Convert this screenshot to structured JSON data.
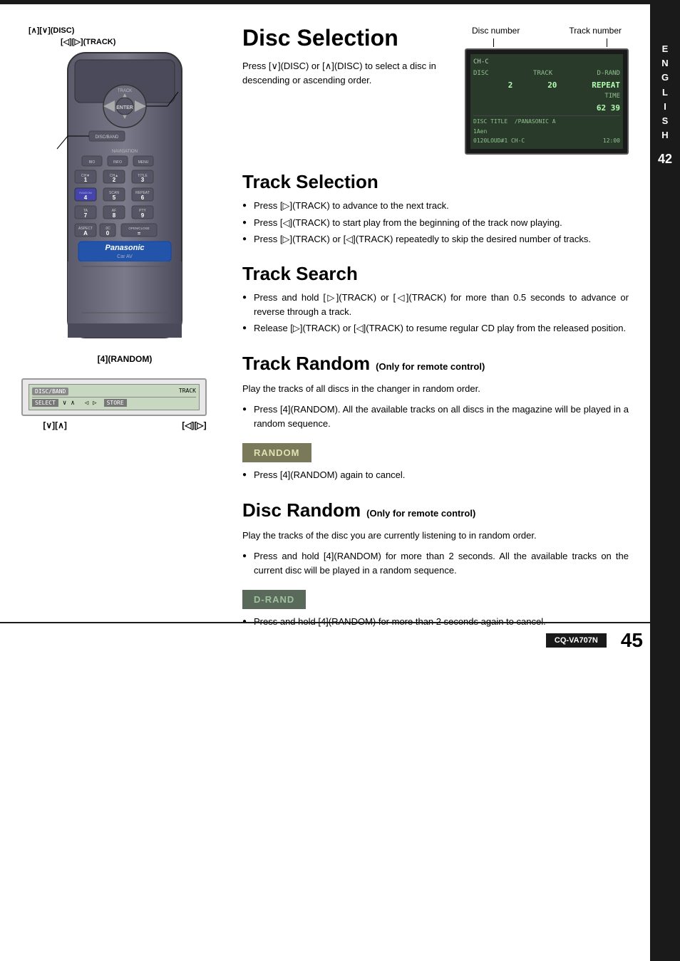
{
  "page": {
    "top_border": true,
    "page_number": "45",
    "model_number": "CQ-VA707N"
  },
  "sidebar": {
    "letters": [
      "E",
      "N",
      "G",
      "L",
      "I",
      "S",
      "H"
    ],
    "page": "42"
  },
  "disc_selection": {
    "title": "Disc Selection",
    "intro": "Press [∨](DISC) or [∧](DISC) to select a disc in descending or ascending order.",
    "disc_number_label": "Disc number",
    "track_number_label": "Track number",
    "screen_lines": [
      "CH-C",
      "DISC  TRACK  D-RAND",
      "       2    20   REPEAT",
      "                 62 39",
      "DISC TITLE  /PANASONIC A",
      "1Aen",
      "0120LOUD#1 CH-C       12:00"
    ]
  },
  "track_selection": {
    "title": "Track Selection",
    "bullets": [
      "Press [▷](TRACK) to advance to the next track.",
      "Press [◁](TRACK) to start play from the beginning of the track now playing.",
      "Press [▷](TRACK) or [◁](TRACK) repeatedly to skip the desired number of tracks."
    ]
  },
  "track_search": {
    "title": "Track Search",
    "bullets": [
      "Press and hold [▷](TRACK) or [◁](TRACK) for more than 0.5 seconds to advance or reverse through a track.",
      "Release [▷](TRACK) or [◁](TRACK) to resume regular CD play from the released position."
    ]
  },
  "track_random": {
    "title_big": "Track Random",
    "title_small": "(Only for remote control)",
    "intro": "Play the tracks of all discs in the changer in random order.",
    "bullets": [
      "Press [4](RANDOM). All the available tracks on all discs in the magazine will be played in a random sequence."
    ],
    "badge_label": "RANDOM",
    "bullet2": "Press [4](RANDOM) again to cancel."
  },
  "disc_random": {
    "title_big": "Disc Random",
    "title_small": "(Only for remote control)",
    "intro": "Play the tracks of the disc you are currently listening to in random order.",
    "bullets": [
      "Press and hold [4](RANDOM) for more than 2 seconds. All the available tracks on the current disc will be played in a random sequence."
    ],
    "badge_label": "D-RAND",
    "bullet2": "Press and hold [4](RANDOM) for more than 2 seconds again to cancel."
  },
  "remote_labels": {
    "disc_label": "[∧][∨](DISC)",
    "track_label": "[◁][▷](TRACK)",
    "random_label": "[4](RANDOM)"
  },
  "display_labels": {
    "left_label": "[∨][∧]",
    "right_label": "[◁][▷]"
  }
}
